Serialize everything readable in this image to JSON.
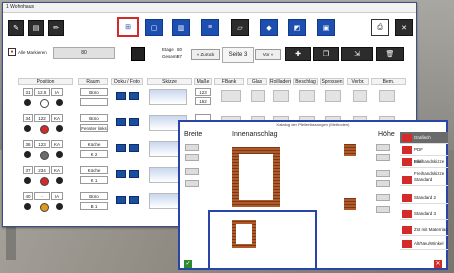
{
  "window": {
    "title": "1 Wohnhaus"
  },
  "toolbar": {
    "markieren_label": "Alle Markieren",
    "field_value": "80",
    "etage_label": "Etage",
    "etage_value": "80",
    "gesamt_label": "Gesamt",
    "gesamt_value": "87",
    "zurueck_label": "« Zurück",
    "page_label": "Seite 3",
    "vor_label": "Vor »"
  },
  "table": {
    "columns": [
      "Position",
      "Raum",
      "Doku / Foto",
      "Skizze",
      "Maße",
      "FBank",
      "Glas",
      "Rollladen",
      "Beschlag",
      "Sprossen",
      "Verbr.",
      "Bem."
    ],
    "rows": [
      {
        "pos": "31",
        "size": "12.5",
        "code": "IA",
        "raum1": "Büro",
        "raum2": "",
        "m1": "123",
        "m2": "152"
      },
      {
        "pos": "34",
        "size": "122",
        "code": "KA",
        "raum1": "Büro",
        "raum2": "Fenster links",
        "m1": "",
        "m2": ""
      },
      {
        "pos": "36",
        "size": "123",
        "code": "KA",
        "raum1": "Küche",
        "raum2": "K 2",
        "m1": "",
        "m2": ""
      },
      {
        "pos": "37",
        "size": "234",
        "code": "KA",
        "raum1": "Küche",
        "raum2": "K 1",
        "m1": "",
        "m2": ""
      },
      {
        "pos": "40",
        "size": "-",
        "code": "IA",
        "raum1": "Büro",
        "raum2": "B 1",
        "m1": "",
        "m2": ""
      }
    ]
  },
  "dialog": {
    "title": "Katalog der Pfeilerfassungen (Methoden)",
    "breite": "Breite",
    "innenanschlag": "Innenanschlag",
    "hoehe": "Höhe",
    "list": [
      "Grafisch",
      "PDF Freihandskizze",
      "Bild Freihandskizze",
      "Standard",
      "Standard 2",
      "Standard 3",
      "Zst mit Materrias",
      "Alt/Neu/Winkel"
    ]
  },
  "colors": {
    "accent": "#2b44a8",
    "danger": "#d42a2a",
    "dark": "#2c2c2c"
  }
}
